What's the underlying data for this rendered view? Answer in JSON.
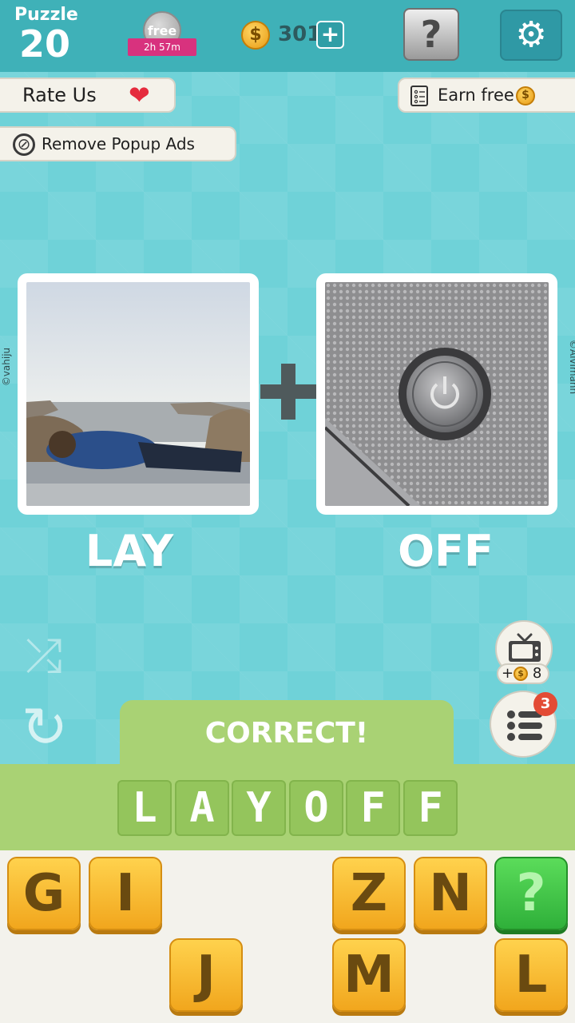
{
  "header": {
    "puzzle_label": "Puzzle",
    "puzzle_number": "20",
    "free_label": "free",
    "free_timer": "2h 57m",
    "coin_symbol": "$",
    "coins": "301",
    "add_label": "+",
    "help_label": "?",
    "settings_icon": "⚙"
  },
  "side": {
    "rate_us": "Rate Us",
    "heart": "❤",
    "earn_free": "Earn free",
    "remove_ads": "Remove Popup Ads",
    "no_ads_symbol": "⊘"
  },
  "puzzle": {
    "left_word": "LAY",
    "right_word": "OFF",
    "left_credit": "©vahiju",
    "right_credit": "©Alvimann"
  },
  "actions": {
    "shuffle_icon": "⤮",
    "reload_icon": "↻",
    "tv_bonus_prefix": "+",
    "tv_bonus_amount": "8",
    "list_badge": "3"
  },
  "result": {
    "banner": "CORRECT!",
    "answer_letters": [
      "L",
      "A",
      "Y",
      "O",
      "F",
      "F"
    ]
  },
  "keyboard": {
    "row1": [
      "G",
      "I",
      "",
      "",
      "Z",
      "N",
      "?"
    ],
    "row2": [
      "",
      "",
      "J",
      "",
      "M",
      "",
      "L"
    ]
  },
  "colors": {
    "background": "#6fd2d8",
    "topbar": "#3fb1b8",
    "correct_green": "#a9d274",
    "key_orange": "#f1a61d",
    "help_green": "#2fb03a"
  }
}
